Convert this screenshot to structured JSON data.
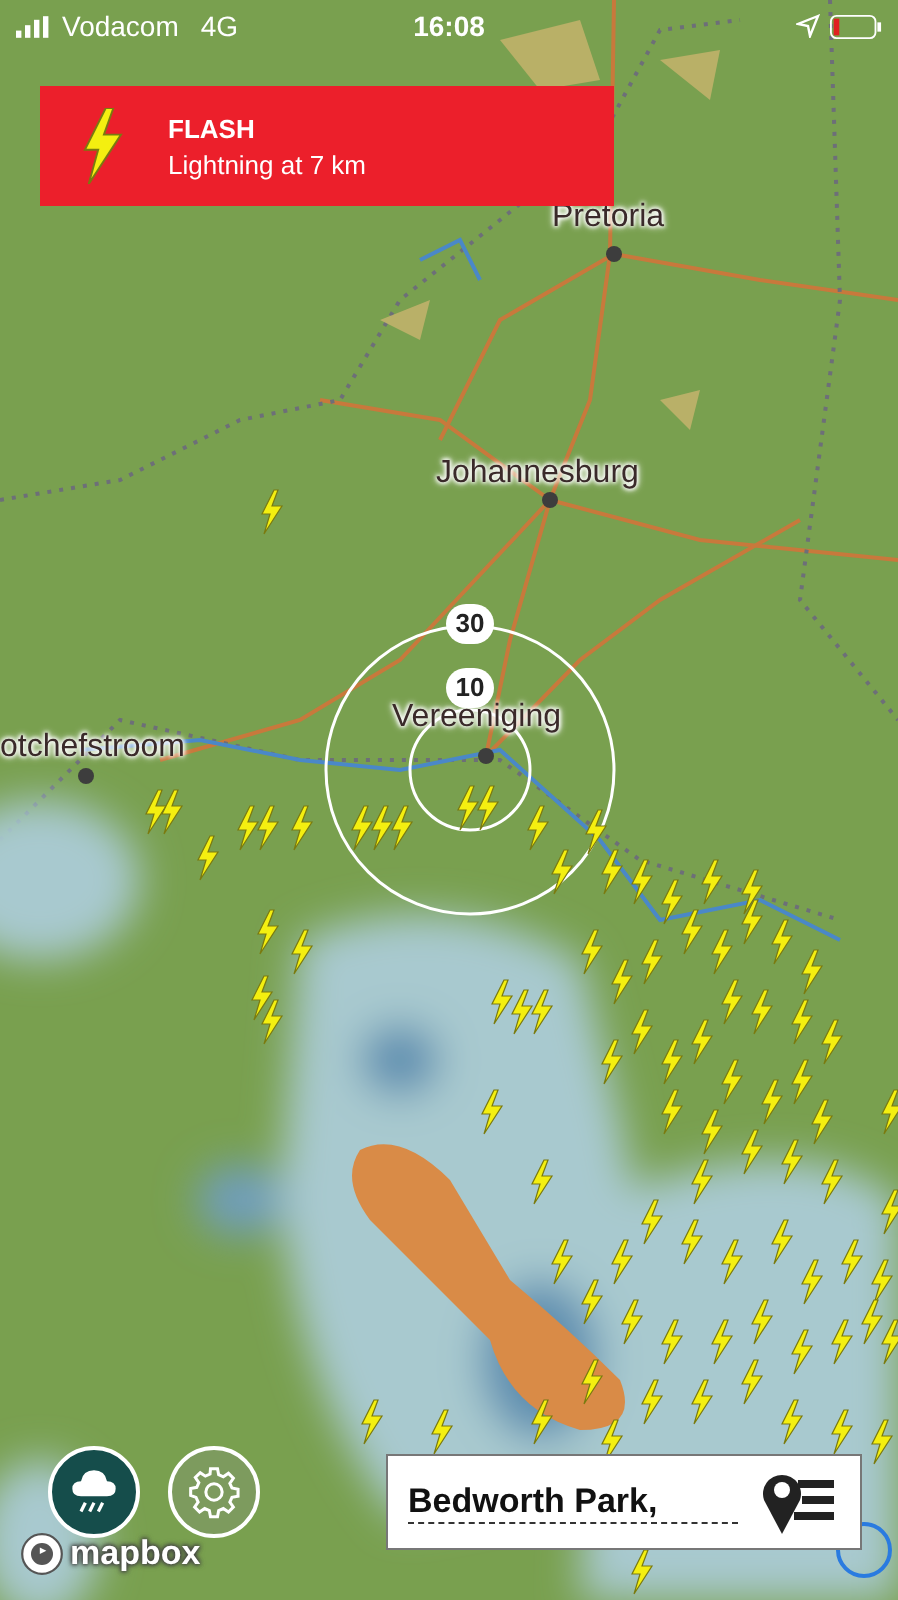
{
  "status_bar": {
    "carrier": "Vodacom",
    "network": "4G",
    "time": "16:08"
  },
  "alert": {
    "title": "FLASH",
    "message": "Lightning at 7 km"
  },
  "map": {
    "places": [
      {
        "name": "Pretoria"
      },
      {
        "name": "Johannesburg"
      },
      {
        "name": "Vereeniging"
      },
      {
        "name": "otchefstroom"
      }
    ],
    "range_rings": [
      {
        "label": "30"
      },
      {
        "label": "10"
      }
    ]
  },
  "controls": [
    {
      "kind": "rain",
      "selected": true
    },
    {
      "kind": "settings",
      "selected": false
    }
  ],
  "location": {
    "value": "Bedworth Park,"
  },
  "attribution": "mapbox"
}
